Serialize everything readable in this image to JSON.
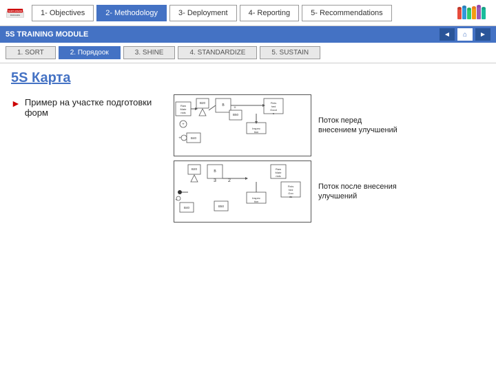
{
  "header": {
    "logo_text": "SAINT-GOBAIN",
    "logo_sub": "PACKAGING"
  },
  "nav_tabs": [
    {
      "id": "objectives",
      "label": "1- Objectives",
      "active": false
    },
    {
      "id": "methodology",
      "label": "2- Methodology",
      "active": true
    },
    {
      "id": "deployment",
      "label": "3- Deployment",
      "active": false
    },
    {
      "id": "reporting",
      "label": "4- Reporting",
      "active": false
    },
    {
      "id": "recommendations",
      "label": "5- Recommendations",
      "active": false
    }
  ],
  "training_bar": {
    "label": "5S TRAINING MODULE"
  },
  "sub_tabs": [
    {
      "id": "sort",
      "label": "1. SORT",
      "active": false
    },
    {
      "id": "poryadok",
      "label": "2. Порядоок",
      "active": true
    },
    {
      "id": "shine",
      "label": "3. SHINE",
      "active": false
    },
    {
      "id": "standardize",
      "label": "4. STANDARDIZE",
      "active": false
    },
    {
      "id": "sustain",
      "label": "5. SUSTAIN",
      "active": false
    }
  ],
  "page": {
    "title": "5S Карта",
    "bullet_text": "Пример на участке подготовки форм",
    "diagram1_label": "Поток перед внесением улучшений",
    "diagram2_label": "Поток после внесения улучшений"
  },
  "nav_arrows": {
    "prev": "◄",
    "home": "⌂",
    "next": "►"
  }
}
